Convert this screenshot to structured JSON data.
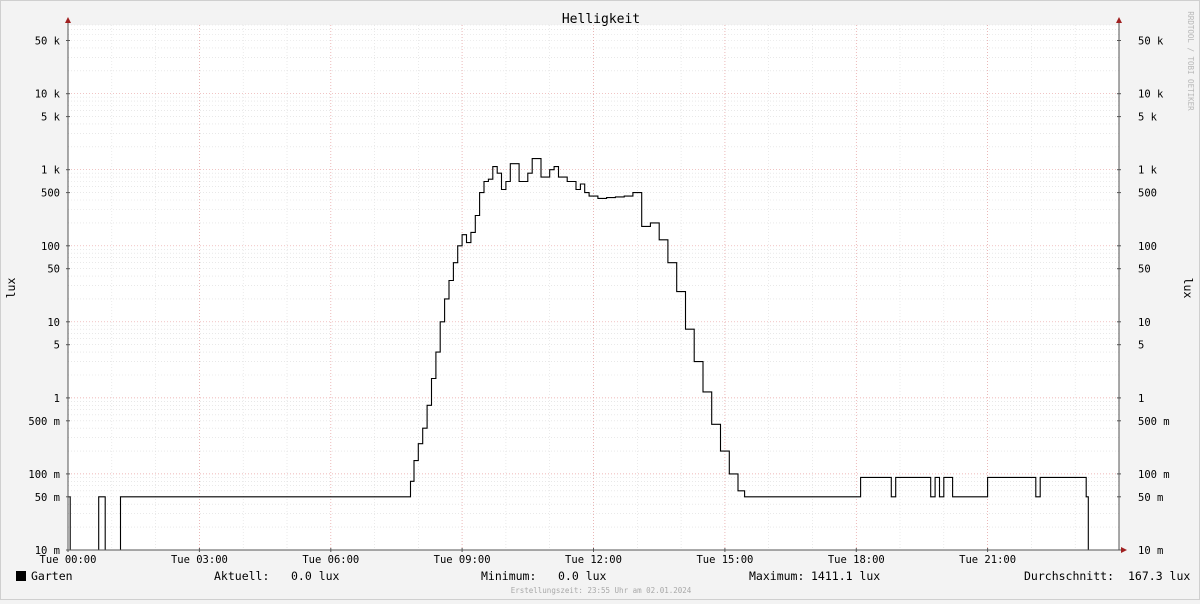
{
  "chart_data": {
    "type": "line",
    "title": "Helligkeit",
    "ylabel": "lux",
    "yscale": "log",
    "ylim": [
      0.01,
      80000
    ],
    "xlim": [
      0,
      24
    ],
    "grid": true,
    "y_ticks": [
      {
        "v": 50000,
        "label": "50 k"
      },
      {
        "v": 10000,
        "label": "10 k"
      },
      {
        "v": 5000,
        "label": "5 k"
      },
      {
        "v": 1000,
        "label": "1 k"
      },
      {
        "v": 500,
        "label": "500"
      },
      {
        "v": 100,
        "label": "100"
      },
      {
        "v": 50,
        "label": "50"
      },
      {
        "v": 10,
        "label": "10"
      },
      {
        "v": 5,
        "label": "5"
      },
      {
        "v": 1,
        "label": "1"
      },
      {
        "v": 0.5,
        "label": "500 m"
      },
      {
        "v": 0.1,
        "label": "100 m"
      },
      {
        "v": 0.05,
        "label": "50 m"
      },
      {
        "v": 0.01,
        "label": "10 m"
      }
    ],
    "x_ticks": [
      {
        "v": 0,
        "label": "Tue 00:00"
      },
      {
        "v": 3,
        "label": "Tue 03:00"
      },
      {
        "v": 6,
        "label": "Tue 06:00"
      },
      {
        "v": 9,
        "label": "Tue 09:00"
      },
      {
        "v": 12,
        "label": "Tue 12:00"
      },
      {
        "v": 15,
        "label": "Tue 15:00"
      },
      {
        "v": 18,
        "label": "Tue 18:00"
      },
      {
        "v": 21,
        "label": "Tue 21:00"
      }
    ],
    "series": [
      {
        "name": "Garten",
        "color": "#000000",
        "x": [
          0,
          0.05,
          0.7,
          0.85,
          1.2,
          7.75,
          7.82,
          7.9,
          8.0,
          8.1,
          8.2,
          8.3,
          8.4,
          8.5,
          8.6,
          8.7,
          8.8,
          8.9,
          9.0,
          9.1,
          9.2,
          9.3,
          9.4,
          9.5,
          9.6,
          9.7,
          9.8,
          9.9,
          10.0,
          10.1,
          10.3,
          10.5,
          10.6,
          10.8,
          11.0,
          11.1,
          11.2,
          11.4,
          11.6,
          11.7,
          11.8,
          11.9,
          12.1,
          12.3,
          12.5,
          12.7,
          12.9,
          13.1,
          13.3,
          13.5,
          13.7,
          13.9,
          14.1,
          14.3,
          14.5,
          14.7,
          14.9,
          15.1,
          15.3,
          15.45,
          15.6,
          15.8,
          15.9,
          16.0,
          16.1,
          16.2,
          16.3,
          16.4,
          16.5,
          16.6,
          16.7,
          16.8,
          16.9,
          17.0,
          17.1,
          17.2,
          17.3,
          17.4,
          18.0,
          18.1,
          18.7,
          18.8,
          18.9,
          19.6,
          19.7,
          19.8,
          19.9,
          20.0,
          20.2,
          20.9,
          21.0,
          21.3,
          22.0,
          22.1,
          22.2,
          23.25,
          23.3
        ],
        "y": [
          0.05,
          0.01,
          0.05,
          0.01,
          0.05,
          0.05,
          0.08,
          0.15,
          0.25,
          0.4,
          0.8,
          1.8,
          4,
          10,
          20,
          35,
          60,
          100,
          140,
          110,
          150,
          250,
          500,
          700,
          750,
          1100,
          900,
          550,
          700,
          1200,
          700,
          900,
          1400,
          800,
          1000,
          1100,
          800,
          700,
          550,
          650,
          500,
          450,
          420,
          430,
          440,
          450,
          500,
          180,
          200,
          120,
          60,
          25,
          8,
          3,
          1.2,
          0.45,
          0.2,
          0.1,
          0.06,
          0.05,
          0.05,
          0.05,
          0.05,
          0.05,
          0.05,
          0.05,
          0.05,
          0.05,
          0.05,
          0.05,
          0.05,
          0.05,
          0.05,
          0.05,
          0.05,
          0.05,
          0.05,
          0.05,
          0.05,
          0.09,
          0.09,
          0.05,
          0.09,
          0.09,
          0.05,
          0.09,
          0.05,
          0.09,
          0.05,
          0.05,
          0.09,
          0.09,
          0.09,
          0.05,
          0.09,
          0.05,
          0.01
        ]
      }
    ]
  },
  "legend": {
    "series_name": "Garten",
    "current_label": "Aktuell:",
    "current_value": "0.0 lux",
    "min_label": "Minimum:",
    "min_value": "0.0 lux",
    "max_label": "Maximum:",
    "max_value": "1411.1 lux",
    "avg_label": "Durchschnitt:",
    "avg_value": "167.3 lux"
  },
  "footer": "Erstellungszeit: 23:55 Uhr am 02.01.2024",
  "watermark": "RRDTOOL / TOBI OETIKER"
}
